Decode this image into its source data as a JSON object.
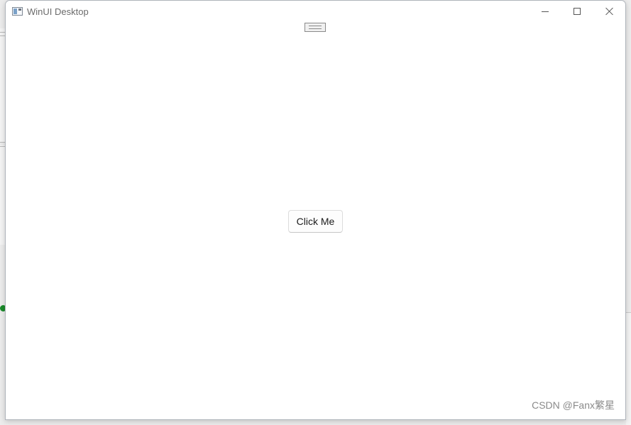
{
  "window": {
    "title": "WinUI Desktop",
    "icon": "app-window-icon"
  },
  "caption_buttons": {
    "minimize_icon": "minimize-icon",
    "maximize_icon": "maximize-icon",
    "close_icon": "close-icon"
  },
  "content": {
    "drag_handle_icon": "drag-handle-icon",
    "button_label": "Click Me"
  },
  "watermark": {
    "text": "CSDN @Fanx繁星"
  },
  "colors": {
    "window_bg": "#ffffff",
    "title_text": "#6b6b6b",
    "button_border": "#dcdcdc",
    "status_check": "#1a8a2a"
  }
}
